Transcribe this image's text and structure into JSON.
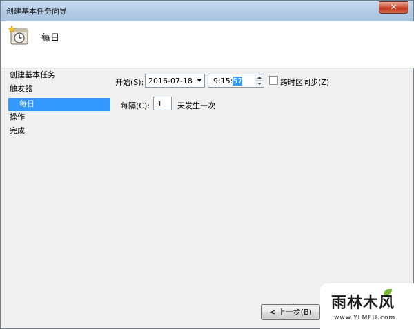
{
  "window": {
    "title": "创建基本任务向导",
    "close_glyph": "✕"
  },
  "header": {
    "title": "每日",
    "icon": "task-scheduler-clock-icon"
  },
  "nav": {
    "items": [
      {
        "label": "创建基本任务",
        "selected": false
      },
      {
        "label": "触发器",
        "selected": false
      },
      {
        "label": "每日",
        "selected": true
      },
      {
        "label": "操作",
        "selected": false
      },
      {
        "label": "完成",
        "selected": false
      }
    ]
  },
  "form": {
    "start_label": "开始(S):",
    "start_date": "2016-07-18",
    "start_time_prefix": "9:15:",
    "start_time_selected": "57",
    "sync_timezone_label": "跨时区同步(Z)",
    "sync_timezone_checked": false,
    "recur_label": "每隔(C):",
    "recur_value": "1",
    "recur_suffix": "天发生一次"
  },
  "buttons": {
    "back": "< 上一步(B)"
  },
  "watermark": {
    "logo": "雨林木风",
    "url": "www.YLMFU.com"
  },
  "colors": {
    "selection": "#3399ff",
    "titlebar": "#b3cbe6",
    "close": "#c2381b"
  }
}
